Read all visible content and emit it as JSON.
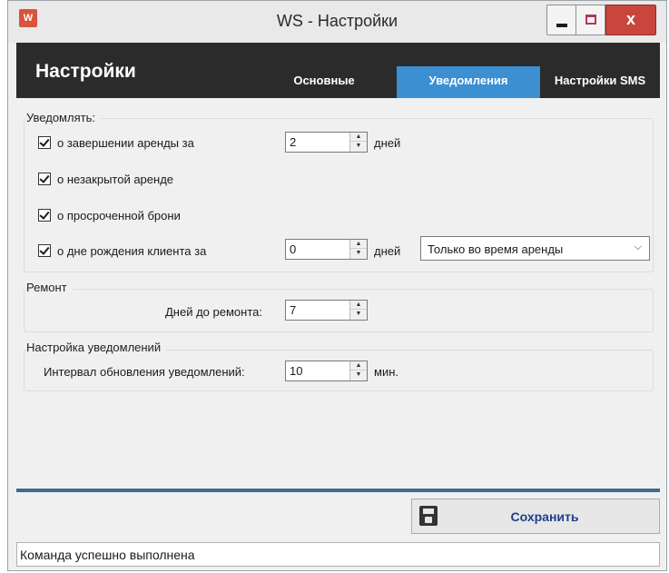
{
  "window": {
    "title": "WS - Настройки",
    "app_icon_text": "W",
    "close_label": "x"
  },
  "header": {
    "title": "Настройки",
    "tabs": [
      {
        "label": "Основные",
        "active": false
      },
      {
        "label": "Уведомления",
        "active": true
      },
      {
        "label": "Настройки SMS",
        "active": false
      }
    ]
  },
  "notify_group": {
    "title": "Уведомлять:",
    "rent_end": {
      "label": "о завершении аренды за",
      "checked": true,
      "value": "2",
      "unit": "дней"
    },
    "unclosed": {
      "label": "о незакрытой аренде",
      "checked": true
    },
    "overdue": {
      "label": "о просроченной брони",
      "checked": true
    },
    "birthday": {
      "label": "о дне рождения клиента за",
      "checked": true,
      "value": "0",
      "unit": "дней",
      "mode": "Только во время аренды"
    }
  },
  "repair_group": {
    "title": "Ремонт",
    "days_label": "Дней до ремонта:",
    "days_value": "7"
  },
  "settings_group": {
    "title": "Настройка уведомлений",
    "interval_label": "Интервал обновления уведомлений:",
    "interval_value": "10",
    "interval_unit": "мин."
  },
  "footer": {
    "save_label": "Сохранить"
  },
  "status": {
    "text": "Команда успешно выполнена"
  },
  "colors": {
    "header_bg": "#2b2b2b",
    "active_tab": "#3c8fd1",
    "close_button": "#c8463d",
    "save_text": "#1f3f8a"
  }
}
